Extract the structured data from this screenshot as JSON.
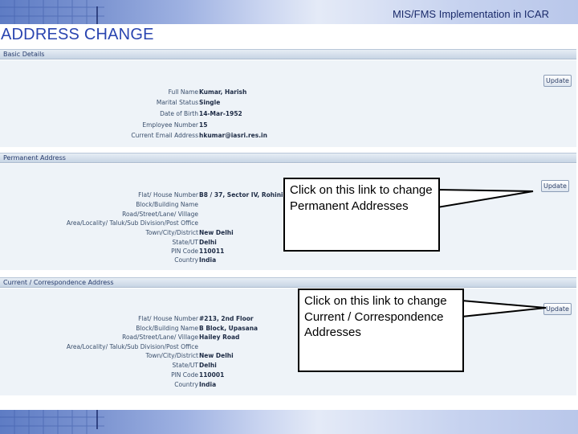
{
  "banner": {
    "title": "MIS/FMS Implementation in ICAR"
  },
  "page_heading": "ADDRESS CHANGE",
  "basic_details": {
    "header": "Basic Details",
    "update_label": "Update",
    "fields": [
      {
        "label": "Full Name",
        "value": "Kumar, Harish"
      },
      {
        "label": "Marital Status",
        "value": "Single"
      },
      {
        "label": "Date of Birth",
        "value": "14-Mar-1952"
      },
      {
        "label": "Employee Number",
        "value": "15"
      },
      {
        "label": "Current Email Address",
        "value": "hkumar@iasri.res.in"
      }
    ]
  },
  "permanent_address": {
    "header": "Permanent Address",
    "update_label": "Update",
    "fields": [
      {
        "label": "Flat/ House Number",
        "value": "B8 / 37, Sector IV, Rohini"
      },
      {
        "label": "Block/Building Name",
        "value": ""
      },
      {
        "label": "Road/Street/Lane/ Village",
        "value": ""
      },
      {
        "label": "Area/Locality/ Taluk/Sub Division/Post Office",
        "value": ""
      },
      {
        "label": "Town/City/District",
        "value": "New Delhi"
      },
      {
        "label": "State/UT",
        "value": "Delhi"
      },
      {
        "label": "PIN Code",
        "value": "110011"
      },
      {
        "label": "Country",
        "value": "India"
      }
    ]
  },
  "current_address": {
    "header": "Current / Correspondence Address",
    "update_label": "Update",
    "fields": [
      {
        "label": "Flat/ House Number",
        "value": "#213, 2nd Floor"
      },
      {
        "label": "Block/Building Name",
        "value": "B Block, Upasana"
      },
      {
        "label": "Road/Street/Lane/ Village",
        "value": "Hailey Road"
      },
      {
        "label": "Area/Locality/ Taluk/Sub Division/Post Office",
        "value": ""
      },
      {
        "label": "Town/City/District",
        "value": "New Delhi"
      },
      {
        "label": "State/UT",
        "value": "Delhi"
      },
      {
        "label": "PIN Code",
        "value": "110001"
      },
      {
        "label": "Country",
        "value": "India"
      }
    ]
  },
  "callouts": {
    "permanent": "Click on this link to change Permanent Addresses",
    "current": "Click on this link to change Current / Correspondence Addresses"
  },
  "colors": {
    "heading": "#2a45b0",
    "banner_text": "#1a2a6a",
    "section_bg": "#eef3f8"
  }
}
